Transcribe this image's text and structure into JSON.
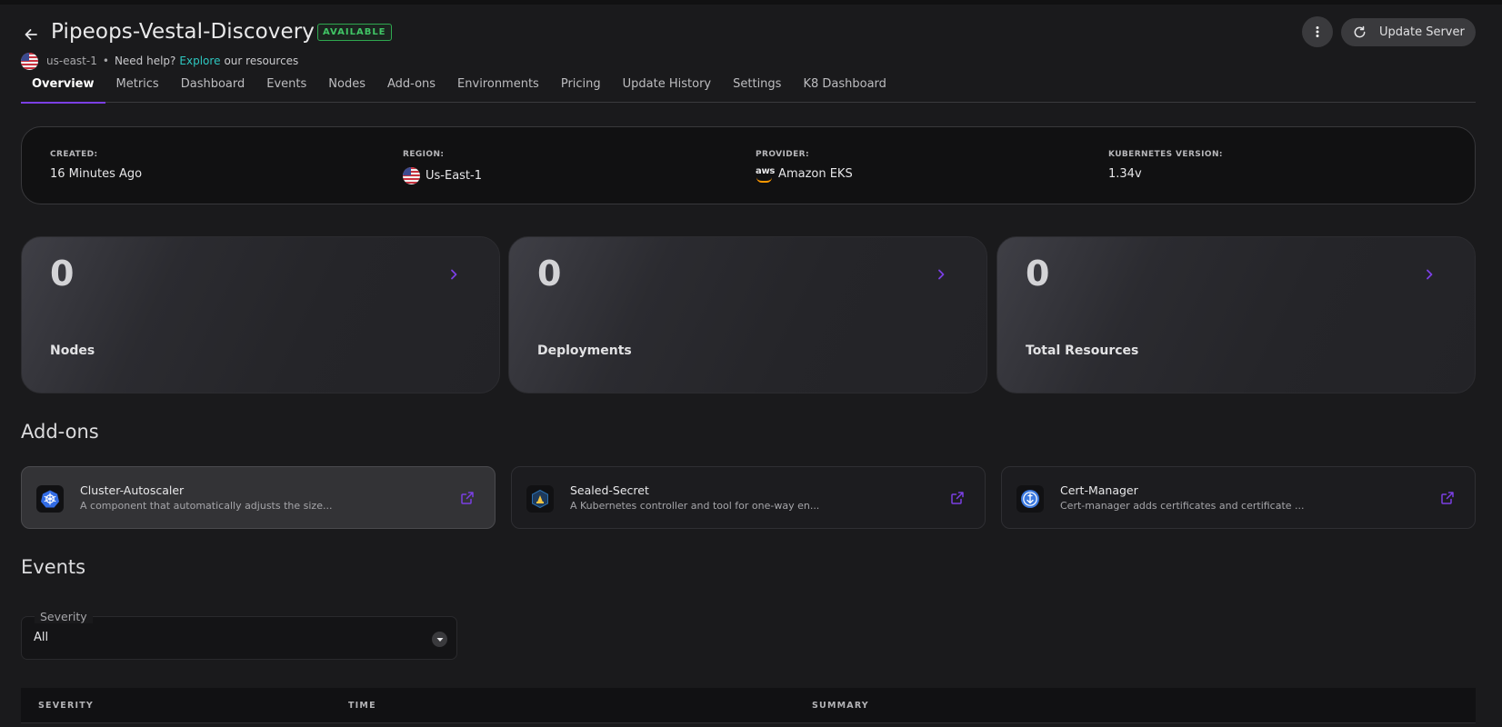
{
  "header": {
    "title": "Pipeops-Vestal-Discovery",
    "status": "AVAILABLE",
    "region": "us-east-1",
    "separator": "•",
    "help_text": "Need help?",
    "explore_link": "Explore",
    "resources_text": "our resources",
    "update_button": "Update Server"
  },
  "tabs": [
    {
      "label": "Overview",
      "active": true
    },
    {
      "label": "Metrics"
    },
    {
      "label": "Dashboard"
    },
    {
      "label": "Events"
    },
    {
      "label": "Nodes"
    },
    {
      "label": "Add-ons"
    },
    {
      "label": "Environments"
    },
    {
      "label": "Pricing"
    },
    {
      "label": "Update History"
    },
    {
      "label": "Settings"
    },
    {
      "label": "K8 Dashboard"
    }
  ],
  "info": {
    "created_label": "CREATED:",
    "created_value": "16 Minutes Ago",
    "region_label": "REGION:",
    "region_value": "Us-East-1",
    "provider_label": "PROVIDER:",
    "provider_logo": "aws",
    "provider_value": "Amazon EKS",
    "k8s_label": "KUBERNETES VERSION:",
    "k8s_value": "1.34v"
  },
  "stats": [
    {
      "value": "0",
      "label": "Nodes"
    },
    {
      "value": "0",
      "label": "Deployments"
    },
    {
      "value": "0",
      "label": "Total Resources"
    }
  ],
  "addons": {
    "title": "Add-ons",
    "items": [
      {
        "name": "Cluster-Autoscaler",
        "description": "A component that automatically adjusts the size...",
        "icon": "kubernetes-icon"
      },
      {
        "name": "Sealed-Secret",
        "description": "A Kubernetes controller and tool for one-way en...",
        "icon": "sealed-secret-icon"
      },
      {
        "name": "Cert-Manager",
        "description": "Cert-manager adds certificates and certificate ...",
        "icon": "cert-manager-icon"
      }
    ]
  },
  "events": {
    "title": "Events",
    "severity_label": "Severity",
    "severity_value": "All",
    "columns": [
      "SEVERITY",
      "TIME",
      "SUMMARY"
    ]
  },
  "colors": {
    "accent": "#7b3fe4",
    "available": "#40c565",
    "link": "#2ec7c0",
    "background": "#1a1a1c"
  }
}
